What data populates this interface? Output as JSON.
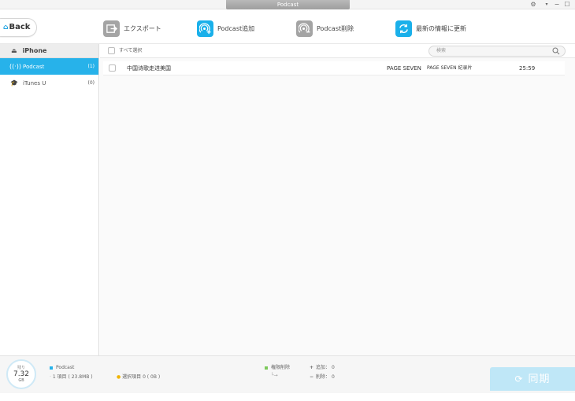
{
  "window": {
    "title": "Podcast",
    "settings_icon": "gear-icon",
    "minimize": "−",
    "maximize": "☐"
  },
  "toolbar": {
    "back_label": "Back",
    "export_label": "エクスポート",
    "add_label": "Podcast追加",
    "delete_label": "Podcast削除",
    "refresh_label": "最新の情報に更新"
  },
  "sidebar": {
    "device": "iPhone",
    "items": [
      {
        "label": "Podcast",
        "count": "(1)",
        "icon": "podcast-icon"
      },
      {
        "label": "iTunes U",
        "count": "(0)",
        "icon": "itunes-u-icon"
      }
    ]
  },
  "list": {
    "select_all": "すべて選択",
    "search_placeholder": "検索",
    "rows": [
      {
        "title": "中国诗歌走进美国",
        "artist": "PAGE SEVEN",
        "album": "PAGE SEVEN 纪录片",
        "duration": "25:59"
      }
    ]
  },
  "footer": {
    "storage_label": "残り",
    "storage_value": "7.32",
    "storage_unit": "GB",
    "category": "Podcast",
    "items_info": "1 項目 ( 23.8MB )",
    "selected_info": "選択項目 0 ( 0B )",
    "legend_label": "権限削除",
    "add_info": "追加： 0",
    "delete_info": "削除： 0",
    "sync_label": "同期",
    "colors": {
      "accent": "#27b2ea",
      "legend_green": "#7cc95b",
      "selected_dot": "#f0b400"
    }
  }
}
